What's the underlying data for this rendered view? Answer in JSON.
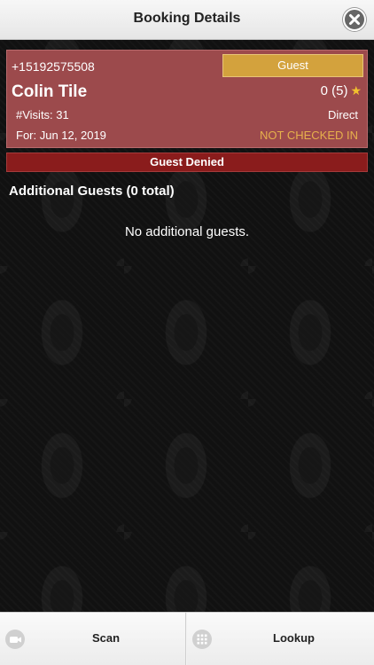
{
  "header": {
    "title": "Booking Details",
    "close_icon": "close-icon"
  },
  "booking": {
    "phone": "+15192575508",
    "guest_type": "Guest",
    "name": "Colin Tile",
    "rating": "0 (5)",
    "rating_icon": "star-icon",
    "visits": "#Visits: 31",
    "source": "Direct",
    "date": "For: Jun 12, 2019",
    "checkin_status": "NOT CHECKED IN"
  },
  "status_banner": "Guest Denied",
  "additional_guests": {
    "heading": "Additional Guests (0 total)",
    "empty_message": "No additional guests."
  },
  "bottom_bar": {
    "scan_label": "Scan",
    "scan_icon": "camera-icon",
    "lookup_label": "Lookup",
    "lookup_icon": "grid-icon"
  },
  "colors": {
    "card_background": "#9c4a4c",
    "guest_badge": "#d3a23d",
    "denied_banner": "#8a1c1c",
    "checkin_status": "#e6b04c",
    "star": "#f2c12e"
  }
}
